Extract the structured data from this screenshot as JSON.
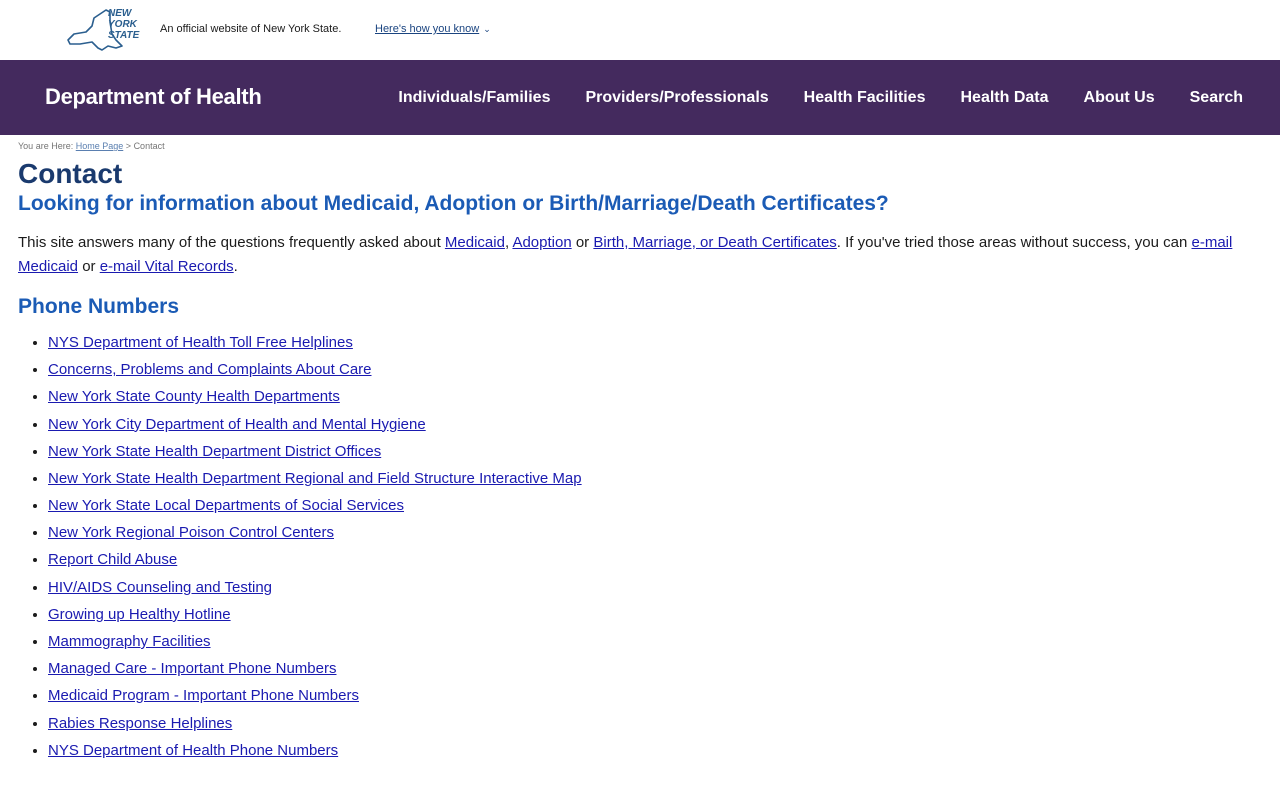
{
  "banner": {
    "logo_text": "NEW YORK STATE",
    "logo_lines": [
      "NEW",
      "YORK",
      "STATE"
    ],
    "official_text": "An official website of New York State.",
    "how_know_label": "Here's how you know"
  },
  "header": {
    "site_title": "Department of Health",
    "nav": [
      {
        "label": "Individuals/Families"
      },
      {
        "label": "Providers/Professionals"
      },
      {
        "label": "Health Facilities"
      },
      {
        "label": "Health Data"
      },
      {
        "label": "About Us"
      },
      {
        "label": "Search"
      }
    ]
  },
  "breadcrumb": {
    "prefix": "You are Here:",
    "home": "Home Page",
    "separator": ">",
    "current": "Contact"
  },
  "page": {
    "title": "Contact",
    "info_heading": "Looking for information about Medicaid, Adoption or Birth/Marriage/Death Certificates?",
    "intro": {
      "t1": "This site answers many of the questions frequently asked about ",
      "link_medicaid": "Medicaid",
      "t2": ", ",
      "link_adoption": "Adoption",
      "t3": " or ",
      "link_certs": "Birth, Marriage, or Death Certificates",
      "t4": ". If you've tried those areas without success, you can ",
      "link_email_medicaid": "e-mail Medicaid",
      "t5": " or ",
      "link_email_vital": "e-mail Vital Records",
      "t6": "."
    },
    "phone_heading": "Phone Numbers",
    "phone_links": [
      "NYS Department of Health Toll Free Helplines",
      "Concerns, Problems and Complaints About Care",
      "New York State County Health Departments",
      "New York City Department of Health and Mental Hygiene",
      "New York State Health Department District Offices",
      "New York State Health Department Regional and Field Structure Interactive Map",
      "New York State Local Departments of Social Services",
      "New York Regional Poison Control Centers",
      "Report Child Abuse",
      "HIV/AIDS Counseling and Testing",
      "Growing up Healthy Hotline",
      "Mammography Facilities",
      "Managed Care - Important Phone Numbers",
      "Medicaid Program - Important Phone Numbers",
      "Rabies Response Helplines",
      "NYS Department of Health Phone Numbers"
    ]
  },
  "colors": {
    "header_bg": "#442a5e",
    "title_blue": "#1a3a6e",
    "heading_blue": "#1b5bb5",
    "link_blue": "#1a1ab0"
  }
}
